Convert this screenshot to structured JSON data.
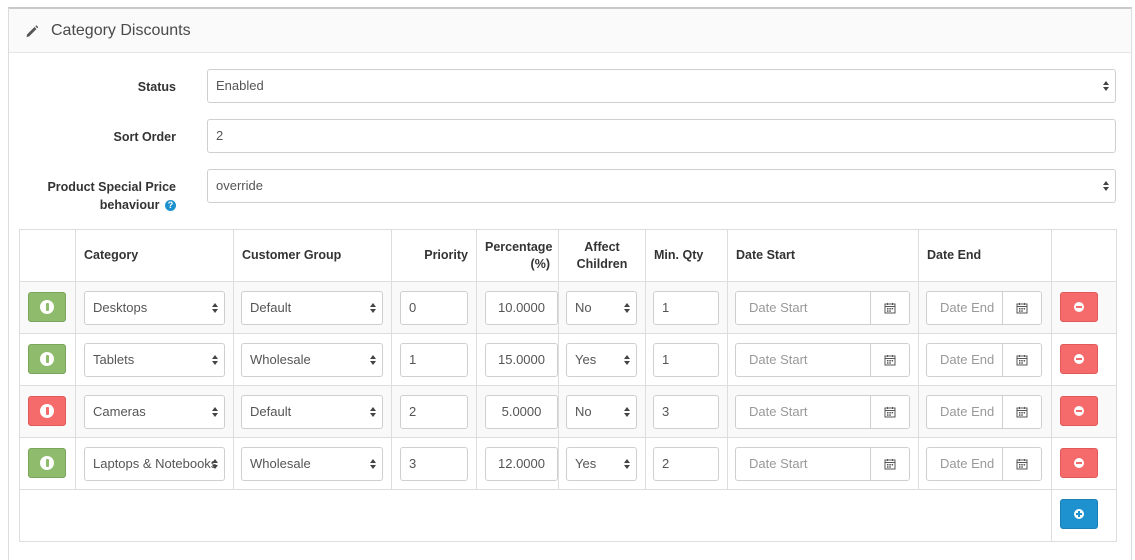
{
  "panel": {
    "title": "Category Discounts"
  },
  "form": {
    "status": {
      "label": "Status",
      "value": "Enabled"
    },
    "sort_order": {
      "label": "Sort Order",
      "value": "2"
    },
    "special_price": {
      "label_line1": "Product Special Price",
      "label_line2": "behaviour",
      "value": "override"
    }
  },
  "table": {
    "headers": {
      "category": "Category",
      "customer_group": "Customer Group",
      "priority": "Priority",
      "percentage_line1": "Percentage",
      "percentage_line2": "(%)",
      "affect_line1": "Affect",
      "affect_line2": "Children",
      "min_qty": "Min. Qty",
      "date_start": "Date Start",
      "date_end": "Date End"
    },
    "placeholders": {
      "date_start": "Date Start",
      "date_end": "Date End"
    },
    "rows": [
      {
        "enabled": true,
        "category": "Desktops",
        "group": "Default",
        "priority": "0",
        "percentage": "10.0000",
        "affect": "No",
        "min_qty": "1"
      },
      {
        "enabled": true,
        "category": "Tablets",
        "group": "Wholesale",
        "priority": "1",
        "percentage": "15.0000",
        "affect": "Yes",
        "min_qty": "1"
      },
      {
        "enabled": false,
        "category": "Cameras",
        "group": "Default",
        "priority": "2",
        "percentage": "5.0000",
        "affect": "No",
        "min_qty": "3"
      },
      {
        "enabled": true,
        "category": "Laptops & Notebooks",
        "group": "Wholesale",
        "priority": "3",
        "percentage": "12.0000",
        "affect": "Yes",
        "min_qty": "2"
      }
    ]
  },
  "colors": {
    "enabled": "#8fbb6c",
    "disabled": "#f56b6b",
    "primary": "#1e91cf"
  }
}
